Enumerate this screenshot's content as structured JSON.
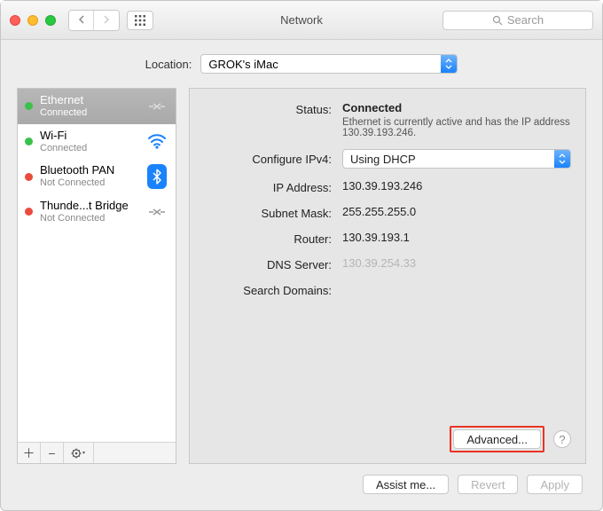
{
  "window": {
    "title": "Network"
  },
  "search": {
    "placeholder": "Search"
  },
  "location": {
    "label": "Location:",
    "value": "GROK's iMac"
  },
  "services": [
    {
      "name": "Ethernet",
      "sub": "Connected",
      "dot": "green",
      "selected": true,
      "icon": "ethernet"
    },
    {
      "name": "Wi-Fi",
      "sub": "Connected",
      "dot": "green",
      "selected": false,
      "icon": "wifi"
    },
    {
      "name": "Bluetooth PAN",
      "sub": "Not Connected",
      "dot": "red",
      "selected": false,
      "icon": "bluetooth"
    },
    {
      "name": "Thunde...t Bridge",
      "sub": "Not Connected",
      "dot": "red",
      "selected": false,
      "icon": "thunderbolt"
    }
  ],
  "status": {
    "label": "Status:",
    "value": "Connected",
    "sub": "Ethernet is currently active and has the IP address 130.39.193.246."
  },
  "fields": {
    "configure_label": "Configure IPv4:",
    "configure_value": "Using DHCP",
    "ip_label": "IP Address:",
    "ip_value": "130.39.193.246",
    "subnet_label": "Subnet Mask:",
    "subnet_value": "255.255.255.0",
    "router_label": "Router:",
    "router_value": "130.39.193.1",
    "dns_label": "DNS Server:",
    "dns_value": "130.39.254.33",
    "search_label": "Search Domains:",
    "search_value": ""
  },
  "buttons": {
    "advanced": "Advanced...",
    "assist": "Assist me...",
    "revert": "Revert",
    "apply": "Apply"
  }
}
